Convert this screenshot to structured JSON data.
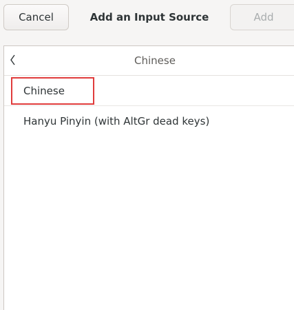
{
  "dialog": {
    "title": "Add an Input Source",
    "cancel_label": "Cancel",
    "add_label": "Add"
  },
  "list": {
    "header_title": "Chinese",
    "back_icon": "chevron-left-icon",
    "items": [
      {
        "label": "Chinese",
        "highlighted": true
      },
      {
        "label": "Hanyu Pinyin (with AltGr dead keys)",
        "highlighted": false
      }
    ]
  },
  "colors": {
    "highlight": "#e03b3b",
    "background": "#f6f5f4",
    "list_background": "#ffffff"
  }
}
